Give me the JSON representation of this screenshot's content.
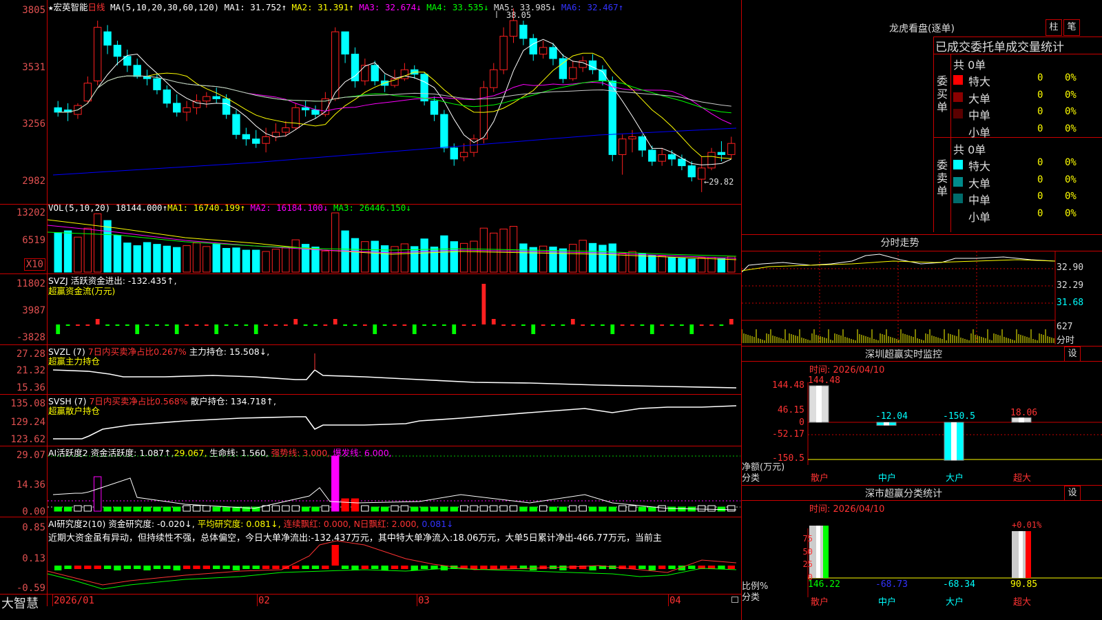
{
  "left_axis": {
    "price": [
      "3805",
      "3531",
      "3256",
      "2982"
    ],
    "vol": [
      "13202",
      "6519"
    ],
    "vol_unit": "X10",
    "svzj": [
      "11802",
      "3987",
      "-3828"
    ],
    "svzl": [
      "27.28",
      "21.32",
      "15.36"
    ],
    "svsh": [
      "135.08",
      "129.24",
      "123.62"
    ],
    "ai1": [
      "29.07",
      "14.36",
      "0.00"
    ],
    "ai2": [
      "0.85",
      "0.13",
      "-0.59"
    ]
  },
  "price_header": {
    "star": "★",
    "name": "宏英智能",
    "period": "日线",
    "ma_def": "MA(5,10,20,30,60,120)",
    "ma1": "MA1: 31.752↑",
    "ma2": "MA2: 31.391↑",
    "ma3": "MA3: 32.674↓",
    "ma4": "MA4: 33.535↓",
    "ma5": "MA5: 33.985↓",
    "ma6": "MA6: 32.467↑"
  },
  "price_annot": {
    "high": "38.05",
    "low": "29.82"
  },
  "vol_header": {
    "def": "VOL(5,10,20)",
    "val": "18144.000↑",
    "ma1": "MA1: 16740.199↑",
    "ma2": "MA2: 16184.100↓",
    "ma3": "MA3: 26446.150↓"
  },
  "svzj_header": {
    "l1": "SVZJ  活跃资金进出: -132.435↑,",
    "l2": "超赢资金流(万元)"
  },
  "svzl_header": {
    "a": "SVZL (7)",
    "b": "7日内买卖净占比0.267%",
    "c": "主力持仓: 15.508↓,",
    "l2": "超赢主力持仓"
  },
  "svsh_header": {
    "a": "SVSH (7)",
    "b": "7日内买卖净占比0.568%",
    "c": "散户持仓: 134.718↑,",
    "l2": "超赢散户持仓"
  },
  "ai1_header": {
    "a": "AI活跃度2 资金活跃度: 1.087↑,",
    "b": "29.067,",
    "c": "生命线: 1.560,",
    "d": "强势线: 3.000,",
    "e": "爆发线: 6.000,"
  },
  "ai2_header": {
    "a": "AI研究度2(10) 资金研究度: -0.020↓,",
    "b": "平均研究度: 0.081↓,",
    "c": "连续飘红: 0.000,",
    "d": "N日飘红: 2.000,",
    "e": "0.081↓"
  },
  "ai2_text": "近期大资金虽有异动，但持续性不强，总体偏空，今日大单净流出:-132.437万元，其中特大单净流入:18.06万元，大单5日累计净出-466.77万元，当前主",
  "x_axis": {
    "brand": "大智慧",
    "d1": "2026/01",
    "d2": "02",
    "d3": "03",
    "d4": "04"
  },
  "panel_lh": {
    "title": "龙虎看盘(逐单)",
    "btn1": "柱",
    "btn2": "笔",
    "subtitle": "已成交委托单成交量统计",
    "buy_side": "委买单",
    "sell_side": "委卖单",
    "buy_total": "共 0单",
    "sell_total": "共 0单",
    "buy_rows": [
      {
        "label": "特大",
        "v": "0",
        "p": "0%",
        "color": "#ff0000"
      },
      {
        "label": "大单",
        "v": "0",
        "p": "0%",
        "color": "#8b0000"
      },
      {
        "label": "中单",
        "v": "0",
        "p": "0%",
        "color": "#5a0000"
      },
      {
        "label": "小单",
        "v": "0",
        "p": "0%",
        "color": "#000000"
      }
    ],
    "sell_rows": [
      {
        "label": "特大",
        "v": "0",
        "p": "0%",
        "color": "#00ffff"
      },
      {
        "label": "大单",
        "v": "0",
        "p": "0%",
        "color": "#008b8b"
      },
      {
        "label": "中单",
        "v": "0",
        "p": "0%",
        "color": "#006b6b"
      },
      {
        "label": "小单",
        "v": "0",
        "p": "0%",
        "color": "#000000"
      }
    ]
  },
  "panel_fs": {
    "title": "分时走势",
    "p1": "32.90",
    "p2": "32.29",
    "p3": "31.68",
    "vol": "627",
    "unit": "分时"
  },
  "panel_rt": {
    "title": "深圳超赢实时监控",
    "btn": "设",
    "time": "时间: 2026/04/10",
    "yaxis": [
      "144.48",
      "46.15",
      "0",
      "-52.17",
      "-150.5"
    ],
    "ylabel1": "净额(万元)",
    "ylabel2": "分类",
    "bars": [
      {
        "label": "散户",
        "value": "144.48"
      },
      {
        "label": "中户",
        "value": "-12.04"
      },
      {
        "label": "大户",
        "value": "-150.5"
      },
      {
        "label": "超大",
        "value": "18.06"
      }
    ]
  },
  "panel_cs": {
    "title": "深市超赢分类统计",
    "btn": "设",
    "time": "时间: 2026/04/10",
    "yaxis": [
      "75",
      "50",
      "25",
      "0"
    ],
    "ylabel1": "比例%",
    "ylabel2": "分类",
    "top_label": "+0.01%",
    "values": [
      "146.22",
      "-68.73",
      "-68.34",
      "90.85"
    ],
    "cats": [
      "散户",
      "中户",
      "大户",
      "超大"
    ]
  },
  "colors": {
    "up": "#ff2020",
    "down": "#00ffff",
    "grid": "#c00000",
    "ma1": "#ffffff",
    "ma2": "#ffff00",
    "ma3": "#ff00ff",
    "ma4": "#00ff00",
    "ma5": "#cccccc",
    "ma6": "#0000ff"
  },
  "chart_data": {
    "type": "candlestick",
    "series_note": "",
    "candles": [
      [
        33.6,
        33.4,
        33.9,
        33.2
      ],
      [
        33.5,
        33.4,
        33.8,
        33.0
      ],
      [
        33.3,
        33.7,
        33.8,
        33.1
      ],
      [
        33.9,
        34.7,
        35.0,
        33.8
      ],
      [
        34.8,
        37.2,
        37.5,
        34.6
      ],
      [
        37.0,
        36.4,
        37.3,
        36.0
      ],
      [
        36.4,
        35.9,
        36.6,
        35.5
      ],
      [
        35.9,
        35.5,
        36.2,
        35.2
      ],
      [
        35.5,
        35.0,
        35.8,
        34.9
      ],
      [
        35.0,
        34.9,
        35.3,
        34.6
      ],
      [
        34.9,
        34.4,
        35.1,
        34.2
      ],
      [
        34.4,
        33.8,
        34.6,
        33.6
      ],
      [
        33.8,
        33.4,
        34.2,
        33.2
      ],
      [
        33.4,
        33.6,
        33.9,
        33.0
      ],
      [
        33.6,
        33.9,
        34.2,
        33.3
      ],
      [
        33.9,
        34.1,
        34.3,
        33.6
      ],
      [
        34.1,
        34.0,
        34.5,
        33.8
      ],
      [
        34.0,
        33.3,
        34.2,
        33.1
      ],
      [
        33.3,
        32.4,
        33.5,
        32.2
      ],
      [
        32.4,
        32.2,
        32.7,
        31.9
      ],
      [
        32.2,
        32.0,
        32.6,
        31.8
      ],
      [
        32.0,
        32.3,
        32.7,
        31.6
      ],
      [
        32.3,
        32.5,
        32.9,
        32.1
      ],
      [
        32.5,
        32.7,
        33.0,
        32.3
      ],
      [
        32.7,
        33.6,
        33.8,
        32.6
      ],
      [
        33.6,
        33.5,
        33.9,
        33.2
      ],
      [
        33.5,
        33.3,
        33.7,
        33.1
      ],
      [
        33.3,
        34.0,
        34.3,
        33.2
      ],
      [
        34.0,
        37.0,
        37.2,
        33.9
      ],
      [
        37.0,
        36.0,
        37.0,
        35.6
      ],
      [
        36.0,
        34.8,
        36.3,
        34.5
      ],
      [
        34.8,
        35.5,
        35.8,
        34.6
      ],
      [
        35.5,
        34.8,
        35.7,
        34.6
      ],
      [
        34.8,
        34.6,
        35.1,
        34.3
      ],
      [
        34.6,
        34.9,
        35.3,
        34.5
      ],
      [
        34.9,
        35.3,
        35.6,
        34.8
      ],
      [
        35.3,
        35.1,
        35.5,
        34.9
      ],
      [
        35.1,
        33.9,
        35.2,
        33.7
      ],
      [
        33.9,
        33.3,
        34.1,
        33.0
      ],
      [
        33.3,
        31.8,
        33.5,
        31.6
      ],
      [
        31.8,
        31.3,
        32.0,
        31.0
      ],
      [
        31.4,
        31.6,
        32.0,
        31.2
      ],
      [
        31.6,
        32.2,
        32.4,
        31.4
      ],
      [
        32.2,
        34.5,
        34.8,
        32.0
      ],
      [
        34.5,
        35.3,
        35.6,
        34.3
      ],
      [
        35.3,
        36.8,
        37.2,
        35.1
      ],
      [
        36.8,
        37.5,
        38.05,
        36.5
      ],
      [
        37.3,
        36.7,
        37.5,
        36.4
      ],
      [
        36.7,
        36.0,
        36.9,
        35.7
      ],
      [
        36.0,
        36.3,
        36.6,
        35.8
      ],
      [
        36.3,
        35.8,
        36.5,
        35.5
      ],
      [
        35.8,
        34.9,
        36.0,
        34.7
      ],
      [
        34.9,
        35.4,
        35.7,
        34.8
      ],
      [
        35.4,
        35.7,
        35.9,
        35.2
      ],
      [
        35.7,
        35.3,
        36.0,
        35.1
      ],
      [
        35.3,
        34.8,
        35.5,
        34.6
      ],
      [
        34.8,
        31.5,
        35.0,
        31.2
      ],
      [
        31.5,
        32.2,
        32.4,
        30.6
      ],
      [
        32.2,
        32.3,
        32.6,
        31.6
      ],
      [
        32.3,
        31.7,
        32.4,
        31.4
      ],
      [
        31.7,
        31.2,
        31.9,
        31.0
      ],
      [
        31.2,
        31.5,
        31.8,
        31.0
      ],
      [
        31.5,
        31.3,
        31.7,
        31.0
      ],
      [
        31.3,
        31.0,
        31.5,
        30.8
      ],
      [
        31.0,
        30.5,
        31.2,
        30.3
      ],
      [
        30.4,
        30.9,
        31.4,
        29.82
      ],
      [
        30.9,
        31.6,
        31.8,
        30.8
      ],
      [
        31.6,
        31.5,
        32.1,
        31.2
      ],
      [
        31.5,
        32.0,
        32.3,
        31.3
      ]
    ],
    "volume": [
      8800,
      9200,
      7800,
      9800,
      13000,
      11500,
      8200,
      6500,
      5900,
      6600,
      6200,
      5800,
      5500,
      5900,
      6500,
      5700,
      6200,
      5300,
      5400,
      4900,
      4900,
      4600,
      5100,
      5400,
      7200,
      6200,
      5600,
      4700,
      13202,
      9200,
      7500,
      6800,
      6900,
      5900,
      5700,
      6300,
      5700,
      7400,
      5600,
      8100,
      6800,
      6400,
      6900,
      9800,
      8700,
      9600,
      10200,
      6300,
      5500,
      5800,
      5600,
      5200,
      6200,
      7100,
      6400,
      6000,
      6300,
      4200,
      4600,
      4100,
      3700,
      3600,
      3300,
      3100,
      2900,
      3200,
      3300,
      3000,
      3500
    ],
    "ma_values": {
      "MA1": "31.752",
      "MA2": "31.391",
      "MA3": "32.674",
      "MA4": "33.535",
      "MA5": "33.985",
      "MA6": "32.467"
    },
    "high_label": "38.05",
    "low_label": "29.82",
    "ylim": [
      29.6,
      38.3
    ]
  }
}
